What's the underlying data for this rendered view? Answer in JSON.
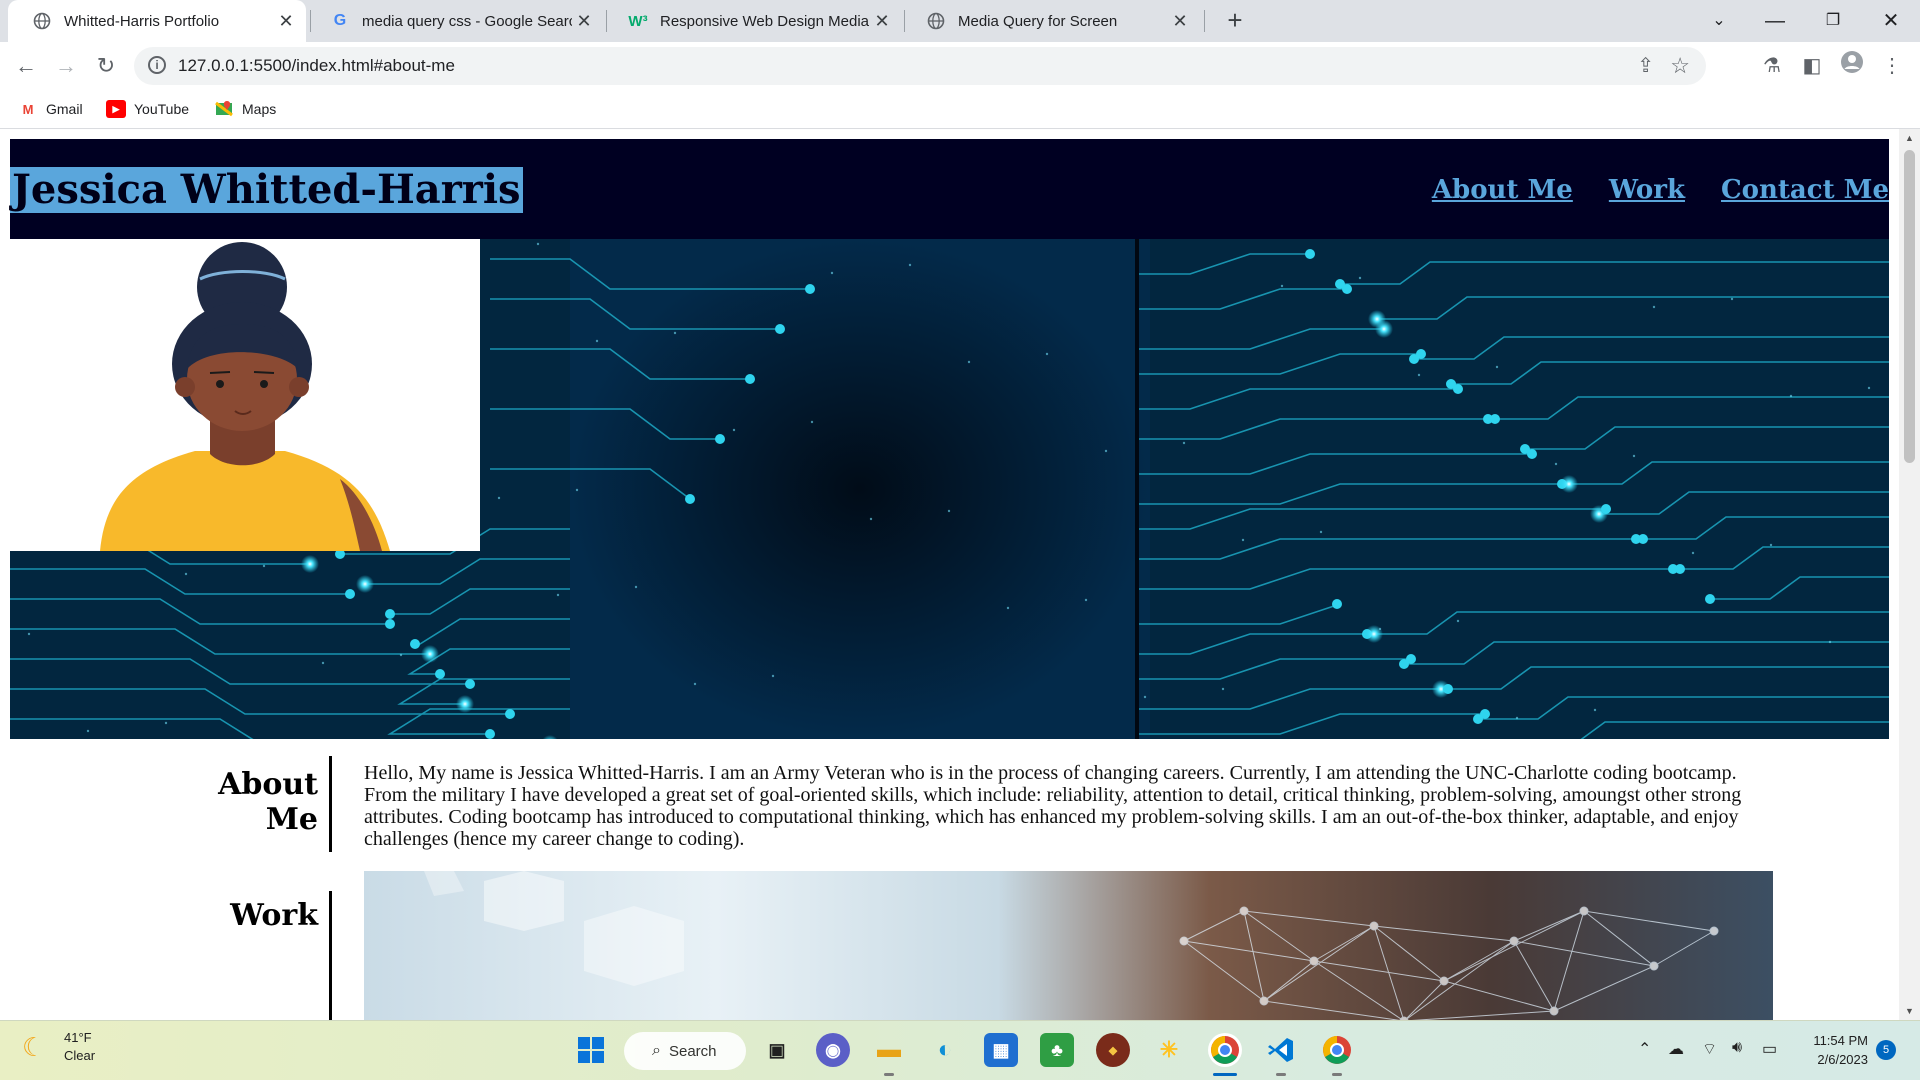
{
  "browser": {
    "tabs": [
      {
        "title": "Whitted-Harris Portfolio",
        "icon": "globe-icon",
        "active": true
      },
      {
        "title": "media query css - Google Search",
        "icon": "google-icon"
      },
      {
        "title": "Responsive Web Design Media Queries",
        "icon": "w3schools-icon"
      },
      {
        "title": "Media Query for Screen",
        "icon": "globe-icon"
      }
    ],
    "url": "127.0.0.1:5500/index.html#about-me",
    "bookmarks": [
      {
        "label": "Gmail",
        "icon": "gmail-icon"
      },
      {
        "label": "YouTube",
        "icon": "youtube-icon"
      },
      {
        "label": "Maps",
        "icon": "maps-icon"
      }
    ]
  },
  "site": {
    "title": "Jessica Whitted-Harris",
    "nav": [
      "About Me",
      "Work",
      "Contact Me"
    ],
    "about": {
      "heading_line1": "About",
      "heading_line2": "Me",
      "text": "Hello, My name is Jessica Whitted-Harris. I am an Army Veteran who is in the process of changing careers. Currently, I am attending the UNC-Charlotte coding bootcamp. From the military I have developed a great set of goal-oriented skills, which include: reliability, attention to detail, critical thinking, problem-solving, amoungst other strong attributes. Coding bootcamp has introduced to computational thinking, which has enhanced my problem-solving skills. I am an out-of-the-box thinker, adaptable, and enjoy challenges (hence my career change to coding)."
    },
    "work": {
      "heading": "Work"
    }
  },
  "taskbar": {
    "weather_temp": "41°F",
    "weather_desc": "Clear",
    "search_label": "Search",
    "time": "11:54 PM",
    "date": "2/6/2023",
    "notification_count": "5"
  },
  "colors": {
    "header_bg": "#000022",
    "title_highlight": "#5aa6dc",
    "nav_link": "#5aa6dc",
    "hero_bg": "#02203a",
    "circuit_glow": "#27d3f0"
  }
}
